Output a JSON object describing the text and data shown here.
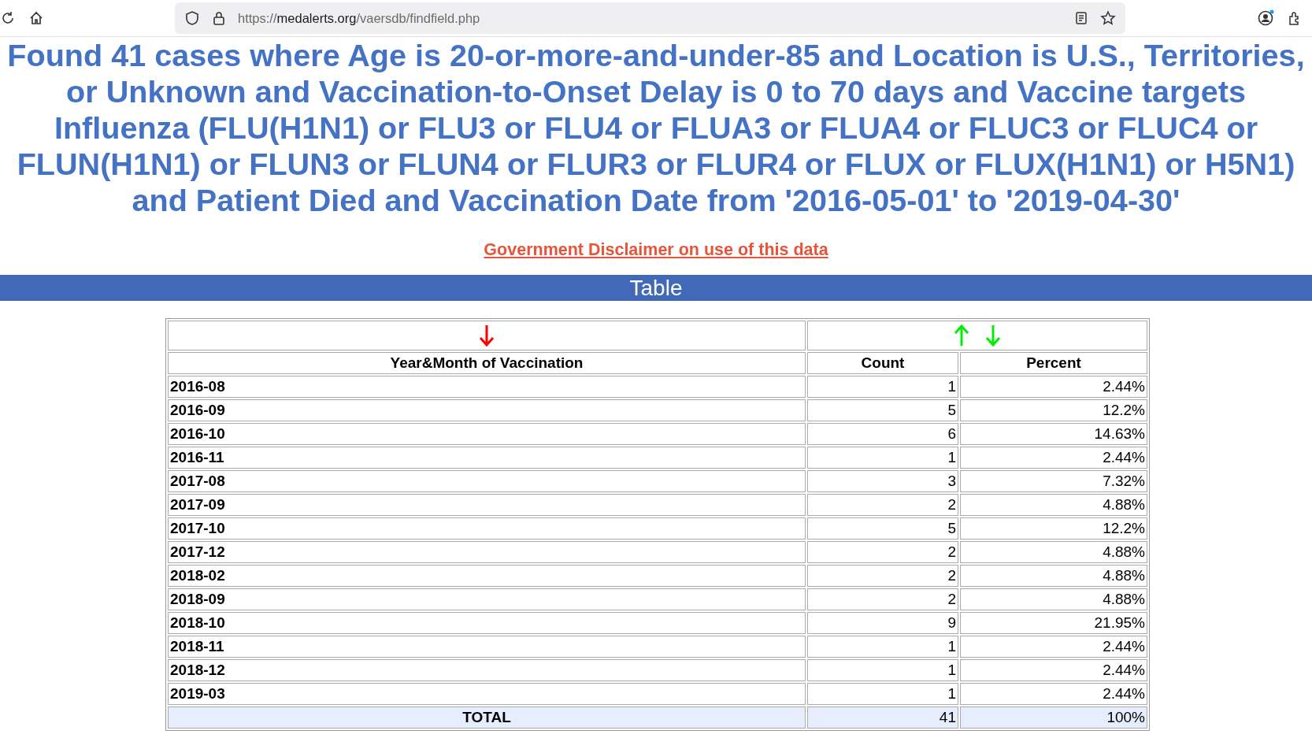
{
  "browser": {
    "url_scheme": "https://",
    "url_host": "medalerts.org",
    "url_path": "/vaersdb/findfield.php"
  },
  "heading": "Found 41 cases where Age is 20-or-more-and-under-85 and Location is U.S., Territories, or Unknown and Vaccination-to-Onset Delay is 0 to 70 days and Vaccine targets Influenza (FLU(H1N1) or FLU3 or FLU4 or FLUA3 or FLUA4 or FLUC3 or FLUC4 or FLUN(H1N1) or FLUN3 or FLUN4 or FLUR3 or FLUR4 or FLUX or FLUX(H1N1) or H5N1) and Patient Died and Vaccination Date from '2016-05-01' to '2019-04-30'",
  "disclaimer_link": "Government Disclaimer on use of this data",
  "section_title": "Table",
  "table": {
    "columns": [
      "Year&Month of Vaccination",
      "Count",
      "Percent"
    ],
    "rows": [
      {
        "month": "2016-08",
        "count": "1",
        "percent": "2.44%"
      },
      {
        "month": "2016-09",
        "count": "5",
        "percent": "12.2%"
      },
      {
        "month": "2016-10",
        "count": "6",
        "percent": "14.63%"
      },
      {
        "month": "2016-11",
        "count": "1",
        "percent": "2.44%"
      },
      {
        "month": "2017-08",
        "count": "3",
        "percent": "7.32%"
      },
      {
        "month": "2017-09",
        "count": "2",
        "percent": "4.88%"
      },
      {
        "month": "2017-10",
        "count": "5",
        "percent": "12.2%"
      },
      {
        "month": "2017-12",
        "count": "2",
        "percent": "4.88%"
      },
      {
        "month": "2018-02",
        "count": "2",
        "percent": "4.88%"
      },
      {
        "month": "2018-09",
        "count": "2",
        "percent": "4.88%"
      },
      {
        "month": "2018-10",
        "count": "9",
        "percent": "21.95%"
      },
      {
        "month": "2018-11",
        "count": "1",
        "percent": "2.44%"
      },
      {
        "month": "2018-12",
        "count": "1",
        "percent": "2.44%"
      },
      {
        "month": "2019-03",
        "count": "1",
        "percent": "2.44%"
      }
    ],
    "total": {
      "label": "TOTAL",
      "count": "41",
      "percent": "100%"
    }
  }
}
